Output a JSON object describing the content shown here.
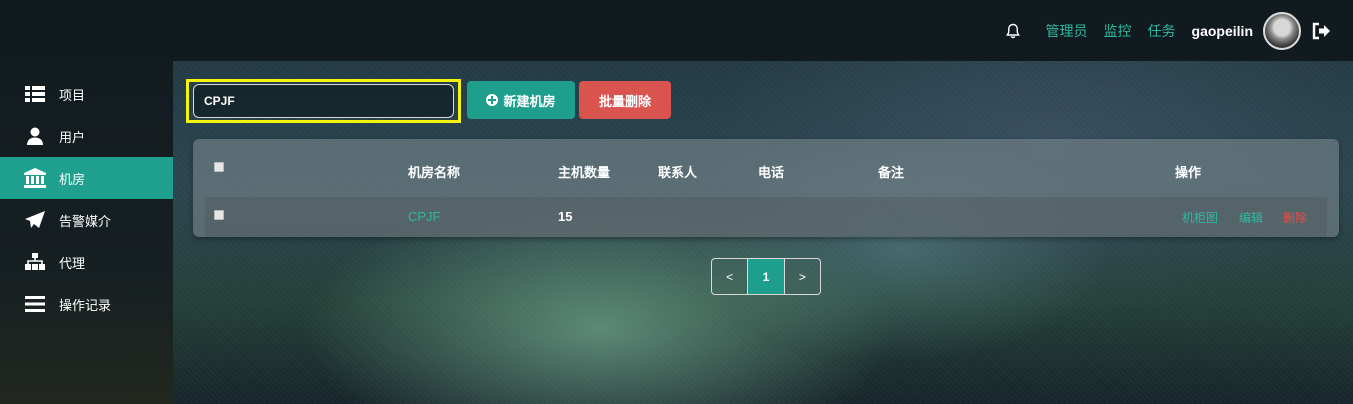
{
  "header": {
    "nav": [
      "管理员",
      "监控",
      "任务"
    ],
    "username": "gaopeilin"
  },
  "sidebar": {
    "items": [
      {
        "label": "项目",
        "icon": "list-icon"
      },
      {
        "label": "用户",
        "icon": "user-icon"
      },
      {
        "label": "机房",
        "icon": "bank-icon",
        "active": true
      },
      {
        "label": "告警媒介",
        "icon": "send-icon"
      },
      {
        "label": "代理",
        "icon": "sitemap-icon"
      },
      {
        "label": "操作记录",
        "icon": "bars-icon"
      }
    ]
  },
  "toolbar": {
    "search_value": "CPJF",
    "new_label": "新建机房",
    "delete_label": "批量删除"
  },
  "table": {
    "headers": [
      "机房名称",
      "主机数量",
      "联系人",
      "电话",
      "备注",
      "操作"
    ],
    "rows": [
      {
        "name": "CPJF",
        "host_count": "15",
        "contact": "",
        "phone": "",
        "note": "",
        "actions": [
          "机柜图",
          "编辑",
          "删除"
        ]
      }
    ]
  },
  "pagination": {
    "prev": "<",
    "current": "1",
    "next": ">"
  },
  "colors": {
    "accent": "#1e9f8e",
    "danger": "#d9534f",
    "highlight": "#f4f40a"
  }
}
